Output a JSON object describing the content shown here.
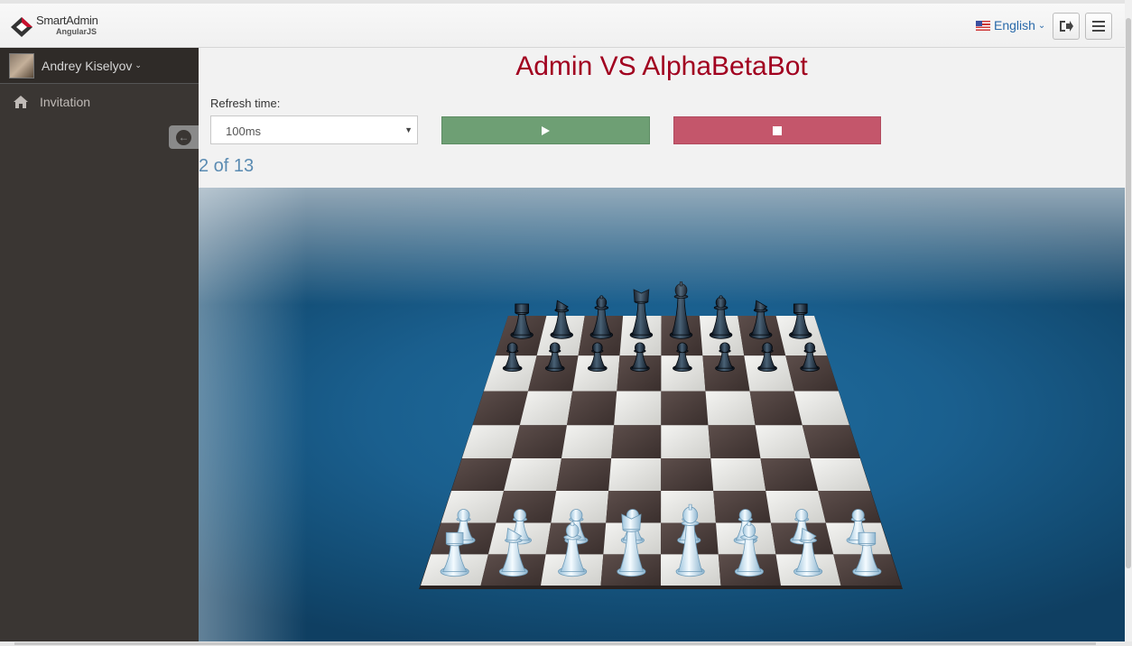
{
  "app": {
    "name": "SmartAdmin",
    "subtitle": "AngularJS"
  },
  "header": {
    "language": "English"
  },
  "sidebar": {
    "user_name": "Andrey Kiselyov",
    "items": [
      {
        "label": "Invitation",
        "icon": "home-icon"
      }
    ]
  },
  "main": {
    "title": "Admin VS AlphaBetaBot",
    "refresh_label": "Refresh time:",
    "refresh_value": "100ms",
    "move_counter": "2 of 13"
  },
  "colors": {
    "title": "#a1001f",
    "play_button": "#6e9f74",
    "stop_button": "#c4566b",
    "counter": "#5a8bb2",
    "sidebar": "#3a3633"
  },
  "board": {
    "ranks": 8,
    "files": 8,
    "black_back_rank": [
      "rook",
      "knight",
      "bishop",
      "queen",
      "king",
      "bishop",
      "knight",
      "rook"
    ],
    "white_back_rank": [
      "rook",
      "knight",
      "bishop",
      "queen",
      "king",
      "bishop",
      "knight",
      "rook"
    ]
  }
}
